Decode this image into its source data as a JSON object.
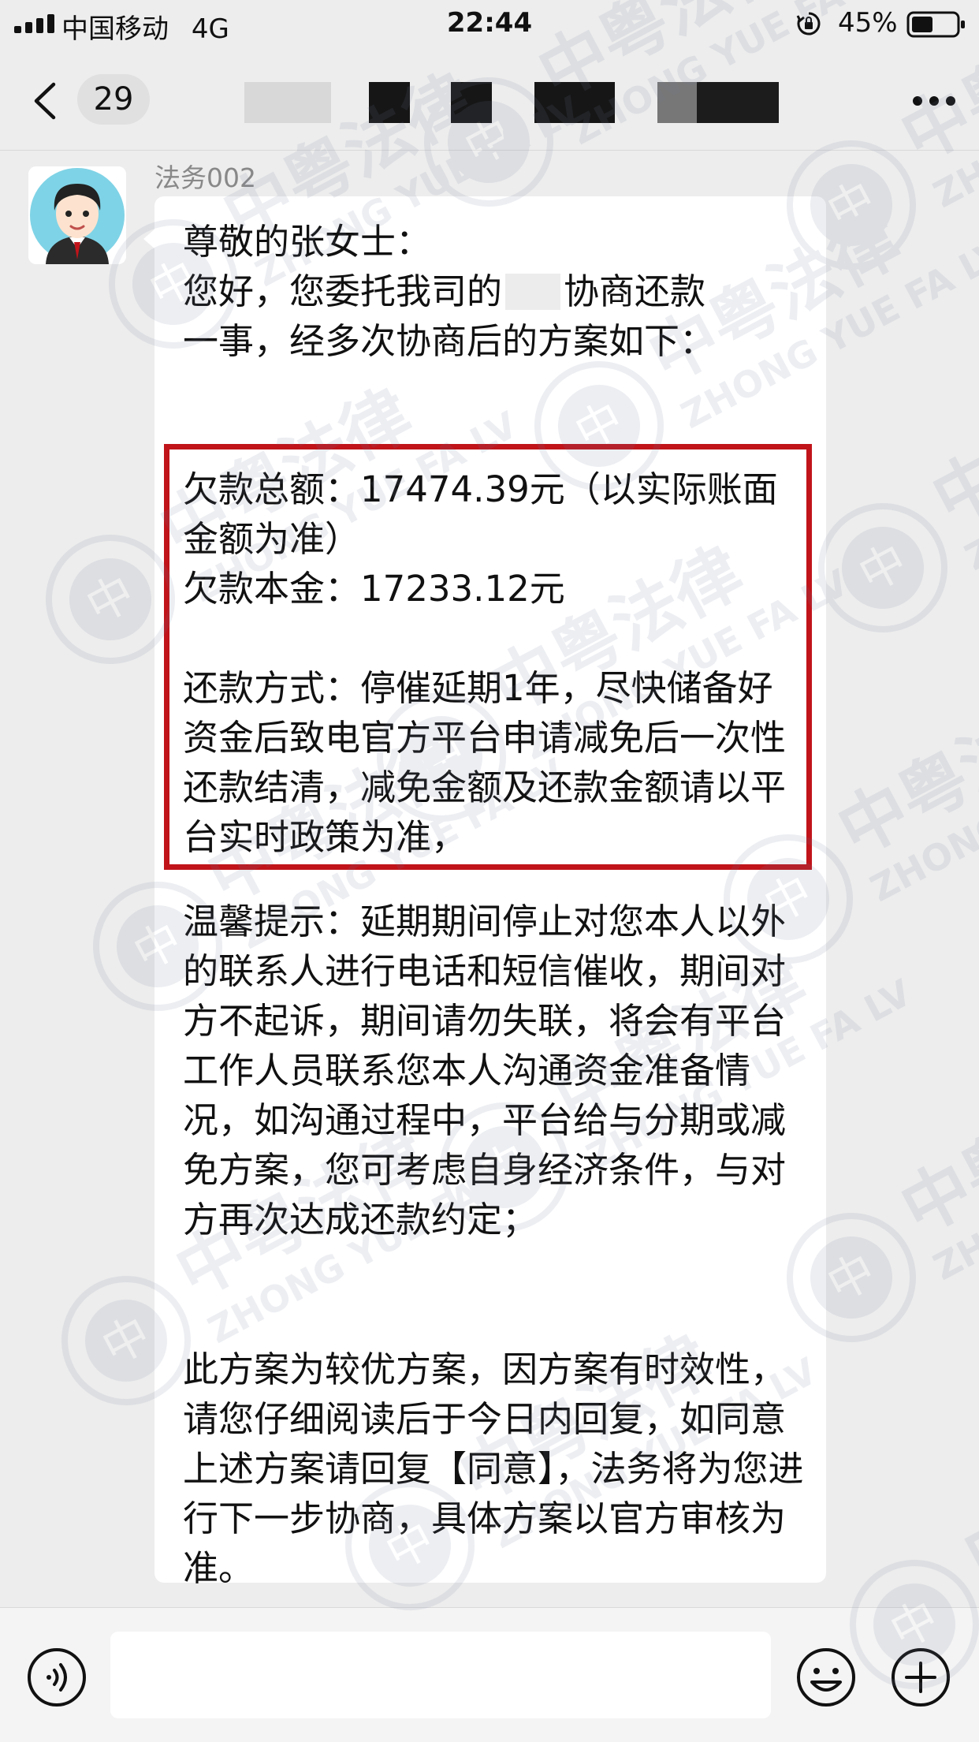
{
  "status_bar": {
    "carrier": "中国移动",
    "network": "4G",
    "time": "22:44",
    "battery": "45%"
  },
  "nav": {
    "unread_count": "29"
  },
  "message": {
    "sender": "法务002",
    "greeting": "尊敬的张女士：",
    "intro_1": "您好，您委托我司的",
    "intro_2": "协商还款",
    "intro_3": "一事，经多次协商后的方案如下：",
    "total_debt": "欠款总额：17474.39元（以实际账面金额为准）",
    "principal": "欠款本金：17233.12元",
    "repayment": "还款方式：停催延期1年，尽快储备好资金后致电官方平台申请减免后一次性还款结清，减免金额及还款金额请以平台实时政策为准，",
    "tip": "温馨提示：延期期间停止对您本人以外的联系人进行电话和短信催收，期间对方不起诉，期间请勿失联，将会有平台工作人员联系您本人沟通资金准备情况，如沟通过程中，平台给与分期或减免方案，您可考虑自身经济条件，与对方再次达成还款约定；",
    "closing": "此方案为较优方案，因方案有时效性，请您仔细阅读后于今日内回复，如同意上述方案请回复【同意】，法务将为您进行下一步协商，具体方案以官方审核为准。"
  },
  "watermark": {
    "cn": "中粤法律",
    "en": "ZHONG YUE FA LV",
    "seal": "中"
  },
  "colors": {
    "background": "#ededed",
    "bubble": "#ffffff",
    "highlight": "#c0141a"
  },
  "icons": [
    "signal-icon",
    "rotation-lock-icon",
    "battery-icon",
    "back-chevron-icon",
    "more-icon",
    "voice-icon",
    "emoji-icon",
    "plus-icon"
  ]
}
